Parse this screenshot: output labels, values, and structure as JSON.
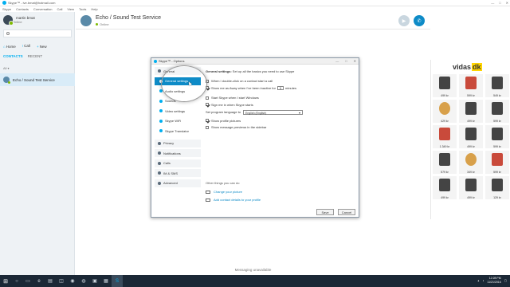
{
  "window": {
    "title": "Skype™ - ive.bmat@hotmail.com",
    "controls": [
      "—",
      "□",
      "✕"
    ]
  },
  "menu": [
    "Skype",
    "Contacts",
    "Conversation",
    "Call",
    "View",
    "Tools",
    "Help"
  ],
  "profile": {
    "name": "martin bmat",
    "status": "Online"
  },
  "nav": {
    "home": "Home",
    "call": "Call",
    "new": "New"
  },
  "tabs": {
    "contacts": "CONTACTS",
    "recent": "RECENT"
  },
  "filter": "All ▾",
  "contact": {
    "name": "Echo / Sound Test Service"
  },
  "header": {
    "name": "Echo / Sound Test Service",
    "status": "Online"
  },
  "dialog": {
    "title": "Skype™ - Options",
    "nav": [
      {
        "label": "General",
        "type": "group"
      },
      {
        "label": "General settings",
        "type": "sub",
        "selected": true
      },
      {
        "label": "Audio settings",
        "type": "sub"
      },
      {
        "label": "Sounds",
        "type": "sub"
      },
      {
        "label": "Video settings",
        "type": "sub"
      },
      {
        "label": "Skype WiFi",
        "type": "sub"
      },
      {
        "label": "Skype Translator",
        "type": "sub"
      },
      {
        "label": "Privacy",
        "type": "group"
      },
      {
        "label": "Notifications",
        "type": "group"
      },
      {
        "label": "Calls",
        "type": "group"
      },
      {
        "label": "IM & SMS",
        "type": "group"
      },
      {
        "label": "Advanced",
        "type": "group"
      }
    ],
    "heading_bold": "General settings:",
    "heading_rest": " Set up all the basics you need to use Skype",
    "opt_doubleclick": "When I double-click on a contact start a call",
    "opt_away_prefix": "Show me as Away when I've been inactive for",
    "away_minutes": "5",
    "opt_away_suffix": "minutes",
    "opt_start_windows": "Start Skype when I start Windows",
    "opt_sign_in": "Sign me in when Skype starts",
    "lang_label": "Set program language to",
    "lang_value": "English (English)",
    "opt_profile_pics": "Show profile pictures",
    "opt_msg_preview": "Show message previews in the sidebar",
    "other_title": "Other things you can do",
    "link_picture": "Change your picture",
    "link_contact": "Add contact details to your profile",
    "save": "Save",
    "cancel": "Cancel"
  },
  "ad": {
    "brand": "vidas",
    "brand_suffix": "dk",
    "prices": [
      "499 kr",
      "599 kr",
      "549 kr",
      "429 kr",
      "499 kr",
      "599 kr",
      "1.349 kr",
      "499 kr",
      "599 kr",
      "579 kr",
      "349 kr",
      "599 kr",
      "499 kr",
      "499 kr",
      "129 kr"
    ]
  },
  "footer": "Messaging unavailable",
  "tray": {
    "time": "12:28 PM",
    "date": "11/21/2016"
  }
}
